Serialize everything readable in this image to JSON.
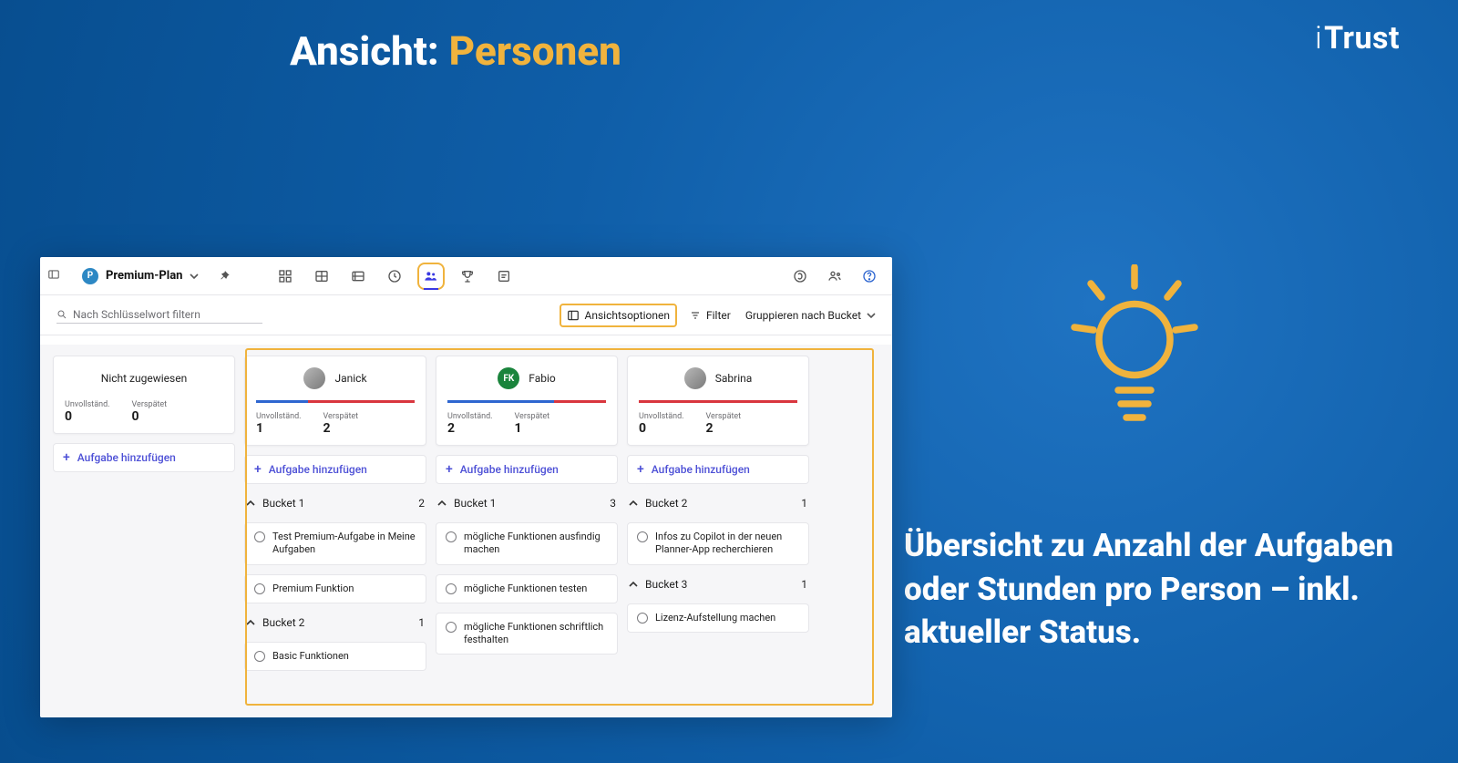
{
  "slide": {
    "title_prefix": "Ansicht: ",
    "title_highlight": "Personen",
    "caption": "Übersicht zu Anzahl der Aufgaben oder Stunden pro Person – inkl. aktueller Status.",
    "brand": "iTrust"
  },
  "app": {
    "plan_name": "Premium-Plan",
    "search_placeholder": "Nach Schlüsselwort filtern",
    "view_options_label": "Ansichtsoptionen",
    "filter_label": "Filter",
    "group_by_label": "Gruppieren nach Bucket",
    "add_task_label": "Aufgabe hinzufügen",
    "stat_labels": {
      "incomplete": "Unvollständ.",
      "late": "Verspätet"
    }
  },
  "columns": [
    {
      "key": "unassigned",
      "title": "Nicht zugewiesen",
      "avatar": null,
      "progress": {
        "blue": 0,
        "red": 0
      },
      "stats": {
        "incomplete": 0,
        "late": 0
      },
      "buckets": []
    },
    {
      "key": "janick",
      "title": "Janick",
      "avatar": {
        "type": "img",
        "initials": ""
      },
      "progress": {
        "blue": 33,
        "red": 67
      },
      "stats": {
        "incomplete": 1,
        "late": 2
      },
      "buckets": [
        {
          "name": "Bucket 1",
          "count": 2,
          "tasks": [
            {
              "title": "Test Premium-Aufgabe in Meine Aufgaben"
            },
            {
              "title": "Premium Funktion"
            }
          ]
        },
        {
          "name": "Bucket 2",
          "count": 1,
          "tasks": [
            {
              "title": "Basic Funktionen"
            }
          ]
        }
      ]
    },
    {
      "key": "fabio",
      "title": "Fabio",
      "avatar": {
        "type": "initials",
        "initials": "FK",
        "color": "green"
      },
      "progress": {
        "blue": 67,
        "red": 33
      },
      "stats": {
        "incomplete": 2,
        "late": 1
      },
      "buckets": [
        {
          "name": "Bucket 1",
          "count": 3,
          "tasks": [
            {
              "title": "mögliche Funktionen ausfindig machen"
            },
            {
              "title": "mögliche Funktionen testen"
            },
            {
              "title": "mögliche Funktionen schriftlich festhalten"
            }
          ]
        }
      ]
    },
    {
      "key": "sabrina",
      "title": "Sabrina",
      "avatar": {
        "type": "img",
        "initials": ""
      },
      "progress": {
        "blue": 0,
        "red": 100
      },
      "stats": {
        "incomplete": 0,
        "late": 2
      },
      "buckets": [
        {
          "name": "Bucket 2",
          "count": 1,
          "tasks": [
            {
              "title": "Infos zu Copilot in der neuen Planner-App recherchieren"
            }
          ]
        },
        {
          "name": "Bucket 3",
          "count": 1,
          "tasks": [
            {
              "title": "Lizenz-Aufstellung machen"
            }
          ]
        }
      ]
    }
  ]
}
